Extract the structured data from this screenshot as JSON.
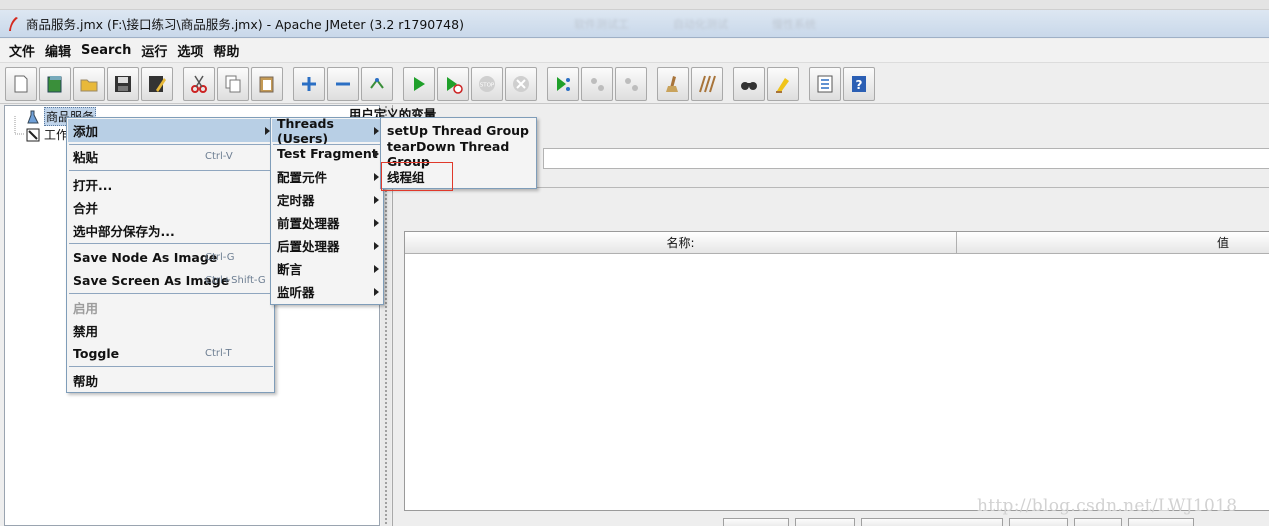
{
  "window": {
    "title": "商品服务.jmx (F:\\接口练习\\商品服务.jmx) - Apache JMeter (3.2 r1790748)",
    "blurred_tabs": [
      "软件测试工",
      "自动化测试",
      "慢性系统"
    ]
  },
  "menubar": [
    "文件",
    "编辑",
    "Search",
    "运行",
    "选项",
    "帮助"
  ],
  "toolbar": [
    {
      "name": "new-icon"
    },
    {
      "name": "templates-icon"
    },
    {
      "name": "open-icon"
    },
    {
      "name": "save-icon"
    },
    {
      "name": "save-as-icon"
    },
    {
      "name": "cut-icon"
    },
    {
      "name": "copy-icon"
    },
    {
      "name": "paste-icon"
    },
    {
      "name": "expand-icon"
    },
    {
      "name": "collapse-icon"
    },
    {
      "name": "toggle-icon"
    },
    {
      "name": "start-icon"
    },
    {
      "name": "start-no-timers-icon"
    },
    {
      "name": "stop-icon"
    },
    {
      "name": "shutdown-icon"
    },
    {
      "name": "remote-start-icon"
    },
    {
      "name": "remote-stop-icon"
    },
    {
      "name": "remote-shutdown-icon"
    },
    {
      "name": "clear-icon"
    },
    {
      "name": "clear-all-icon"
    },
    {
      "name": "search-icon"
    },
    {
      "name": "reset-search-icon"
    },
    {
      "name": "function-helper-icon"
    },
    {
      "name": "help-icon"
    }
  ],
  "tree": {
    "root_label": "商品服务",
    "workbench_label": "工作"
  },
  "context_menu": {
    "items": [
      {
        "label": "添加",
        "shortcut": "",
        "submenu": true,
        "highlight": true
      },
      {
        "label": "粘贴",
        "shortcut": "Ctrl-V"
      },
      {
        "label": "打开..."
      },
      {
        "label": "合并"
      },
      {
        "label": "选中部分保存为..."
      },
      {
        "label": "Save Node As Image",
        "shortcut": "Ctrl-G"
      },
      {
        "label": "Save Screen As Image",
        "shortcut": "Ctrl+Shift-G"
      },
      {
        "label": "启用",
        "disabled": true
      },
      {
        "label": "禁用"
      },
      {
        "label": "Toggle",
        "shortcut": "Ctrl-T"
      },
      {
        "label": "帮助"
      }
    ]
  },
  "add_submenu": {
    "items": [
      "Threads (Users)",
      "Test Fragment",
      "配置元件",
      "定时器",
      "前置处理器",
      "后置处理器",
      "断言",
      "监听器"
    ]
  },
  "threads_submenu": {
    "items": [
      "setUp Thread Group",
      "tearDown Thread Group",
      "线程组"
    ]
  },
  "right_panel": {
    "vars_title": "用户定义的变量",
    "columns": [
      "名称:",
      "值"
    ]
  },
  "watermark": "http://blog.csdn.net/LWJ1018",
  "colors": {
    "menu_highlight": "#b8cfe5",
    "annotation_box": "#e0392b"
  }
}
